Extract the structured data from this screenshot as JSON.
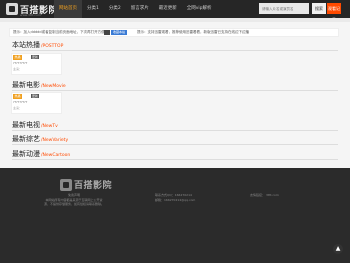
{
  "header": {
    "logo_text": "百搭影院",
    "logo_sub": "www.3ttt.com",
    "nav": [
      "网站首页",
      "分类1",
      "分类2",
      "留言求片",
      "最近更新",
      "全网vip解析"
    ],
    "search_placeholder": "请输入片名或演员名",
    "search_label": "搜索",
    "history_label": "观看记录"
  },
  "notice": {
    "text1": "提示：加入ddddd或者复制当前页面地址，下次再打开方便",
    "badge": "收藏本站",
    "text2": "提示：支持迅雷观看，推荐使用迅雷看看，新版迅雷已支持在线边下边播"
  },
  "sections": [
    {
      "title": "本站热播",
      "en": "/POSTTOP"
    },
    {
      "title": "最新电影",
      "en": "/NewMovie"
    },
    {
      "title": "最新电视",
      "en": "/NewTv"
    },
    {
      "title": "最新综艺",
      "en": "/NewVariety"
    },
    {
      "title": "最新动漫",
      "en": "/NewCartoon"
    }
  ],
  "cards": [
    {
      "tag1": "热播",
      "tag2": "更新",
      "title": "?????????",
      "role": "主演："
    },
    {
      "tag1": "热播",
      "tag2": "更新",
      "title": "?????????",
      "role": "主演："
    }
  ],
  "footer": {
    "logo_text": "百搭影院",
    "about_title": "免责声明",
    "about": "本网站所有内容都是来源于互联网上公开资源，不提供存储服务，如有侵权请联系删除。",
    "qq": "联系方式QQ：166270214",
    "email": "邮箱：166270214@qq.com",
    "link": "友情链接：",
    "link_site": "3ttt.com"
  },
  "colors": {
    "accent": "#ff4a00",
    "nav_active": "#f0a020",
    "dark": "#262626"
  }
}
